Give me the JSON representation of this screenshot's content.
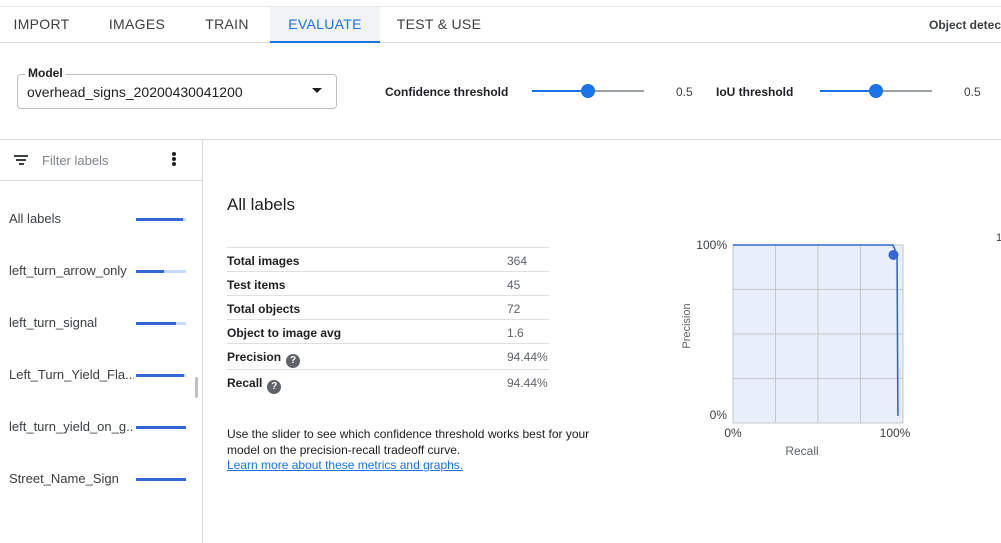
{
  "tabs": [
    {
      "label": "IMPORT"
    },
    {
      "label": "IMAGES"
    },
    {
      "label": "TRAIN"
    },
    {
      "label": "EVALUATE"
    },
    {
      "label": "TEST & USE"
    }
  ],
  "active_tab": "EVALUATE",
  "tab_right_text": "Object detect",
  "model": {
    "label": "Model",
    "value": "overhead_signs_20200430041200"
  },
  "confidence": {
    "label": "Confidence threshold",
    "value": "0.5",
    "level": 0.5
  },
  "iou": {
    "label": "IoU threshold",
    "value": "0.5",
    "level": 0.5
  },
  "filter": {
    "placeholder": "Filter labels",
    "icon": "filter-icon",
    "menu_icon": "more-vert-icon"
  },
  "labels": [
    {
      "name": "All labels",
      "score": 0.944
    },
    {
      "name": "left_turn_arrow_only",
      "score": 0.55
    },
    {
      "name": "left_turn_signal",
      "score": 0.8
    },
    {
      "name": "Left_Turn_Yield_Fla...",
      "score": 0.95
    },
    {
      "name": "left_turn_yield_on_g...",
      "score": 1.0
    },
    {
      "name": "Street_Name_Sign",
      "score": 1.0
    }
  ],
  "main": {
    "title": "All labels",
    "stats": [
      {
        "name": "Total images",
        "value": "364",
        "help": false
      },
      {
        "name": "Test items",
        "value": "45",
        "help": false
      },
      {
        "name": "Total objects",
        "value": "72",
        "help": false
      },
      {
        "name": "Object to image avg",
        "value": "1.6",
        "help": false
      },
      {
        "name": "Precision",
        "value": "94.44%",
        "help": true
      },
      {
        "name": "Recall",
        "value": "94.44%",
        "help": true
      }
    ],
    "help_glyph": "?",
    "info_text": "Use the slider to see which confidence threshold works best for your model on the precision-recall tradeoff curve.",
    "link_text": "Learn more about these metrics and graphs."
  },
  "chart_data": {
    "type": "line",
    "title": "",
    "xlabel": "Recall",
    "ylabel": "Precision",
    "xlim": [
      0,
      1
    ],
    "ylim": [
      0,
      1
    ],
    "x_ticks": [
      "0%",
      "100%"
    ],
    "y_ticks": [
      "0%",
      "100%"
    ],
    "grid": true,
    "series": [
      {
        "x": [
          0.0,
          0.94,
          0.95,
          0.965,
          0.97
        ],
        "y": [
          1.0,
          1.0,
          0.98,
          0.944,
          0.04
        ]
      }
    ],
    "marker": {
      "x": 0.944,
      "y": 0.944
    },
    "colors": {
      "line": "#3367d6",
      "fill": "#e8eefb",
      "grid": "#c4c7c5"
    }
  },
  "right_stub_text": "1"
}
